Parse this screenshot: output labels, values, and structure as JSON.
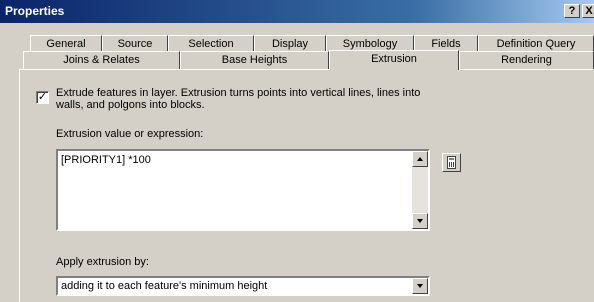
{
  "window": {
    "title": "Properties",
    "help_label": "?",
    "close_label": "X"
  },
  "tabs_row1": [
    "General",
    "Source",
    "Selection",
    "Display",
    "Symbology",
    "Fields",
    "Definition Query"
  ],
  "tabs_row2": [
    "Joins & Relates",
    "Base Heights",
    "Extrusion",
    "Rendering"
  ],
  "active_tab": "Extrusion",
  "extrude": {
    "checked": true,
    "check_mark": "✓",
    "label": "Extrude features in layer.  Extrusion turns points into vertical lines, lines into walls, and polgons into blocks."
  },
  "expression": {
    "label": "Extrusion value or expression:",
    "value": "[PRIORITY1] *100"
  },
  "apply": {
    "label": "Apply extrusion by:",
    "selected": "adding it to each feature's minimum height"
  },
  "icons": {
    "calculator": "calculator-icon",
    "dropdown": "chevron-down-icon"
  }
}
